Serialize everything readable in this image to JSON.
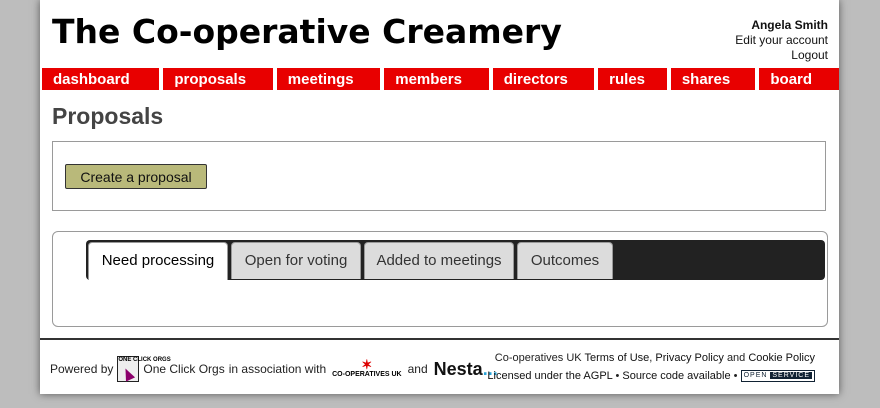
{
  "site": {
    "title": "The Co-operative Creamery"
  },
  "user": {
    "name": "Angela Smith",
    "edit_account": "Edit your account",
    "logout": "Logout"
  },
  "nav": {
    "accent": "#e80000",
    "items": [
      {
        "label": "dashboard"
      },
      {
        "label": "proposals"
      },
      {
        "label": "meetings"
      },
      {
        "label": "members"
      },
      {
        "label": "directors"
      },
      {
        "label": "rules"
      },
      {
        "label": "shares"
      },
      {
        "label": "board"
      }
    ]
  },
  "main": {
    "heading": "Proposals",
    "create_button": "Create a proposal",
    "tabs": [
      {
        "label": "Need processing",
        "active": true
      },
      {
        "label": "Open for voting",
        "active": false
      },
      {
        "label": "Added to meetings",
        "active": false
      },
      {
        "label": "Outcomes",
        "active": false
      }
    ]
  },
  "footer": {
    "powered_by": "Powered by",
    "oco_logo_text": "ONE CLICK ORGS",
    "oco_name": "One Click Orgs",
    "association": "in association with",
    "coop_logo_text": "CO-OPERATIVES UK",
    "and": "and",
    "nesta": "Nesta",
    "nesta_dots": "...",
    "coop_uk": "Co-operatives UK",
    "terms": "Terms of Use",
    "privacy": "Privacy Policy",
    "and2": "and",
    "cookie": "Cookie Policy",
    "licensed": "Licensed under the AGPL",
    "source": "Source code available",
    "badge_open": "OPEN",
    "badge_service": "SERVICE",
    "bullet": "•"
  }
}
